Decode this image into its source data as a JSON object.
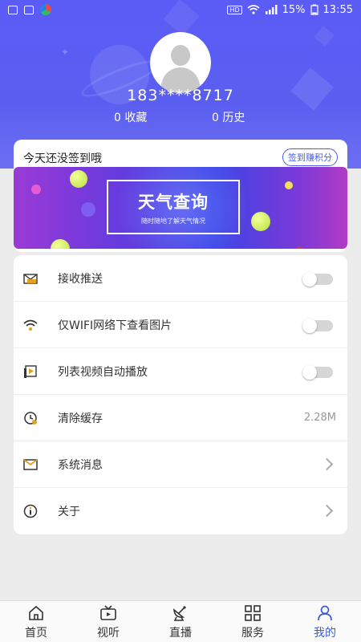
{
  "status_bar": {
    "hd": "HD",
    "signal": "4G",
    "battery": "15%",
    "time": "13:55"
  },
  "profile": {
    "phone": "183****8717",
    "favorites_count": "0",
    "favorites_label": "收藏",
    "history_count": "0",
    "history_label": "历史"
  },
  "sign": {
    "title": "今天还没签到哦",
    "button": "签到赚积分"
  },
  "banner": {
    "title": "天气查询",
    "subtitle": "随时随地了解天气情况"
  },
  "settings": [
    {
      "label": "接收推送",
      "type": "toggle",
      "on": false,
      "icon": "message-icon"
    },
    {
      "label": "仅WIFI网络下查看图片",
      "type": "toggle",
      "on": false,
      "icon": "wifi-icon"
    },
    {
      "label": "列表视频自动播放",
      "type": "toggle",
      "on": false,
      "icon": "video-play-icon"
    },
    {
      "label": "清除缓存",
      "type": "value",
      "value": "2.28M",
      "icon": "clock-icon"
    },
    {
      "label": "系统消息",
      "type": "chevron",
      "icon": "envelope-icon"
    },
    {
      "label": "关于",
      "type": "chevron",
      "icon": "info-icon"
    }
  ],
  "nav": [
    {
      "label": "首页",
      "icon": "home-icon",
      "active": false
    },
    {
      "label": "视听",
      "icon": "tv-icon",
      "active": false
    },
    {
      "label": "直播",
      "icon": "satellite-dish-icon",
      "active": false
    },
    {
      "label": "服务",
      "icon": "grid-icon",
      "active": false
    },
    {
      "label": "我的",
      "icon": "user-icon",
      "active": true
    }
  ],
  "colors": {
    "header": "#5b5cf6",
    "accent": "#3b5bd8",
    "icon_gold": "#e0a020"
  }
}
